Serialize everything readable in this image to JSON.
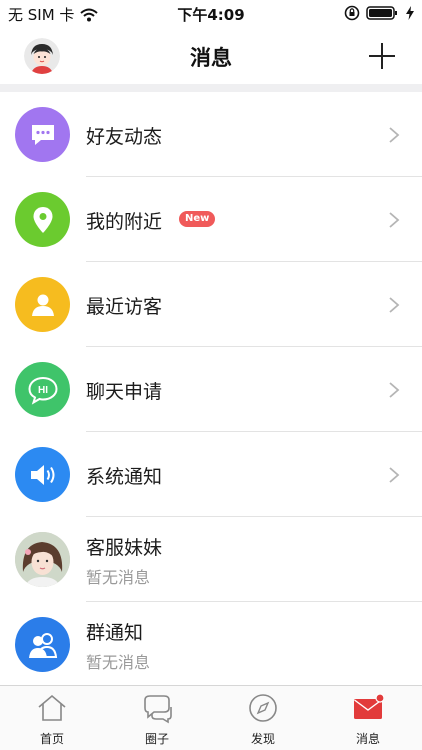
{
  "status_bar": {
    "carrier": "无 SIM 卡",
    "time": "下午4:09"
  },
  "nav": {
    "title": "消息"
  },
  "colors": {
    "purple": "#a176f0",
    "green": "#6bcb2f",
    "yellow": "#f6bc1f",
    "chat_green": "#3fc46a",
    "blue": "#2c8af2",
    "group_blue": "#2b7de9",
    "badge_red": "#f05a5a",
    "mail_red": "#e23b3b"
  },
  "list": {
    "items": [
      {
        "title": "好友动态",
        "icon": "chat-bubble-icon"
      },
      {
        "title": "我的附近",
        "icon": "location-pin-icon",
        "badge": "New"
      },
      {
        "title": "最近访客",
        "icon": "person-icon"
      },
      {
        "title": "聊天申请",
        "icon": "hi-chat-icon",
        "icon_text": "HI"
      },
      {
        "title": "系统通知",
        "icon": "speaker-icon"
      },
      {
        "title": "客服妹妹",
        "subtitle": "暂无消息",
        "icon": "avatar-photo"
      },
      {
        "title": "群通知",
        "subtitle": "暂无消息",
        "icon": "group-icon"
      }
    ]
  },
  "tabs": [
    {
      "label": "首页",
      "icon": "home-icon"
    },
    {
      "label": "圈子",
      "icon": "chat-bubbles-icon"
    },
    {
      "label": "发现",
      "icon": "compass-icon"
    },
    {
      "label": "消息",
      "icon": "mail-icon"
    }
  ]
}
